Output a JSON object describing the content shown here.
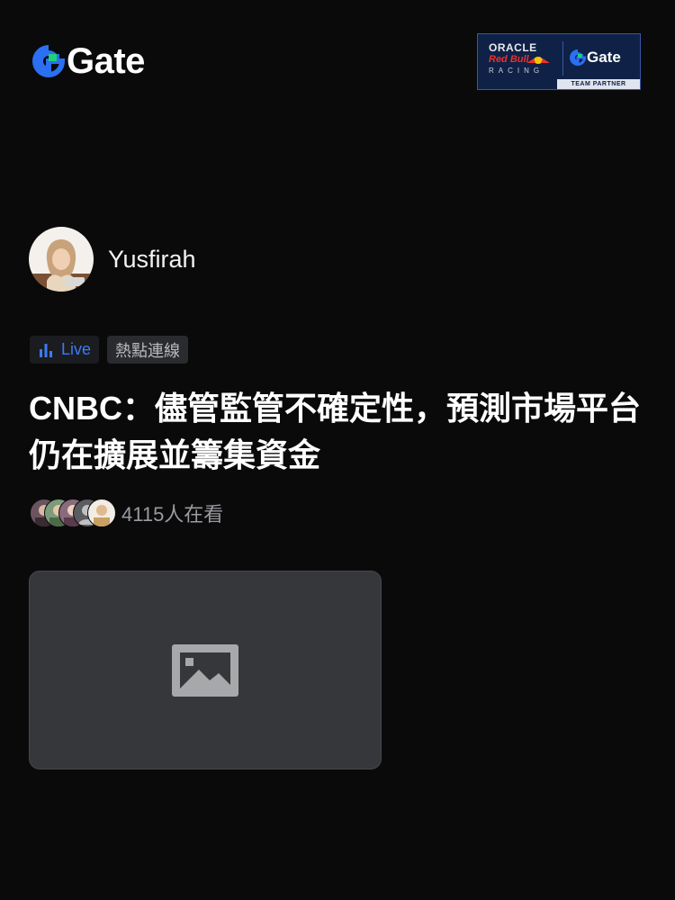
{
  "brand": {
    "name": "Gate",
    "accent": "#2b6ff3",
    "badge": {
      "line1": "ORACLE",
      "line2": "Red Bull",
      "line3": "RACING",
      "partner_brand": "Gate",
      "partner_label": "TEAM PARTNER"
    }
  },
  "author": {
    "name": "Yusfirah",
    "avatar_icon": "avatar-photo"
  },
  "tags": {
    "live_label": "Live",
    "topic_label": "熱點連線"
  },
  "article": {
    "title": "CNBC：儘管監管不確定性，預測市場平台仍在擴展並籌集資金"
  },
  "viewers": {
    "count_text": "4115人在看"
  },
  "media": {
    "placeholder_icon": "image-placeholder-icon"
  }
}
